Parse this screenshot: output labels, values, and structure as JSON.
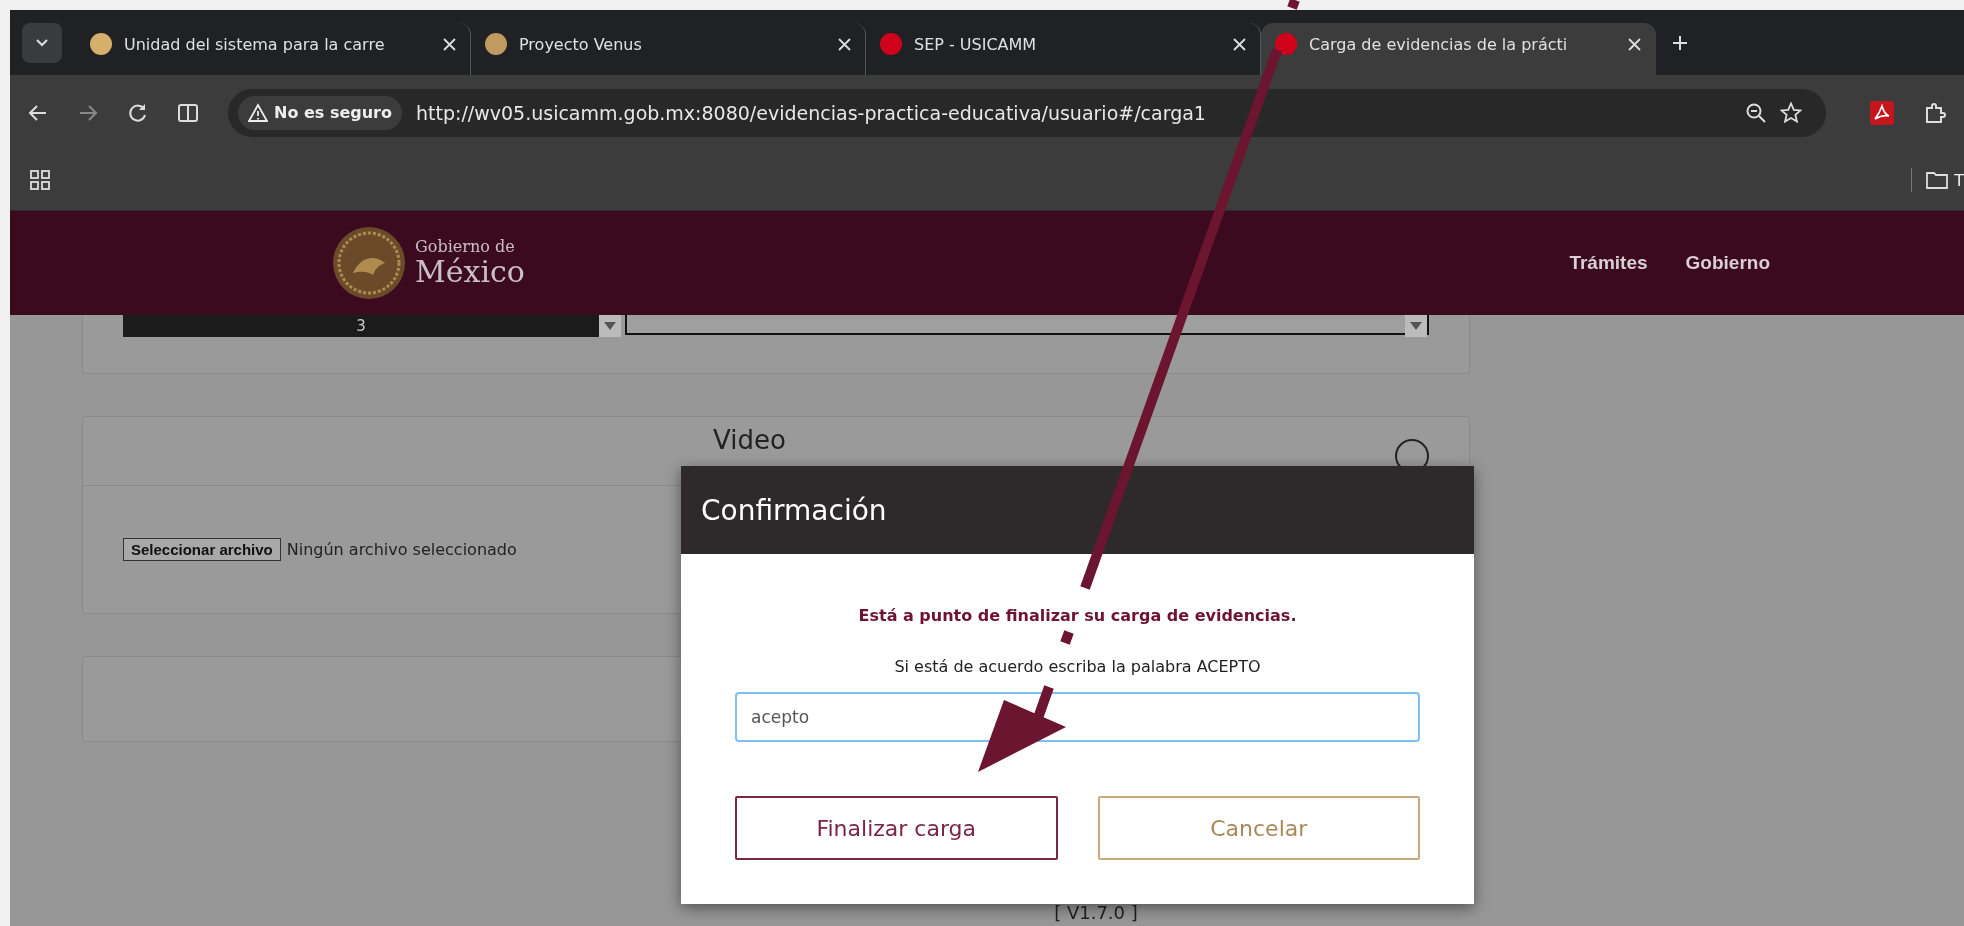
{
  "browser": {
    "tabs": [
      {
        "title": "Unidad del sistema para la carre",
        "color": "#d4b06a",
        "selected": false
      },
      {
        "title": "Proyecto Venus",
        "color": "#c09a5e",
        "selected": false
      },
      {
        "title": "SEP - USICAMM",
        "color": "#d0021b",
        "selected": false
      },
      {
        "title": "Carga de evidencias de la prácti",
        "color": "#d0021b",
        "selected": true
      }
    ],
    "security_label": "No es seguro",
    "url": "http://wv05.usicamm.gob.mx:8080/evidencias-practica-educativa/usuario#/carga1",
    "bookmark": "T"
  },
  "site_header": {
    "logo_line1": "Gobierno de",
    "logo_line2": "México",
    "nav": [
      "Trámites",
      "Gobierno"
    ]
  },
  "form": {
    "select_value": "3",
    "section_title": "Video",
    "file_button": "Seleccionar archivo",
    "file_status": "Ningún archivo seleccionado",
    "version": "[ V1.7.0 ]"
  },
  "dialog": {
    "title": "Confirmación",
    "warning": "Está a punto de finalizar su carga de evidencias.",
    "instruction": "Si está de acuerdo escriba la palabra ACEPTO",
    "input_value": "acepto",
    "buttons": [
      {
        "label": "Finalizar carga",
        "kind": "primary"
      },
      {
        "label": "Cancelar",
        "kind": "secondary"
      }
    ]
  }
}
